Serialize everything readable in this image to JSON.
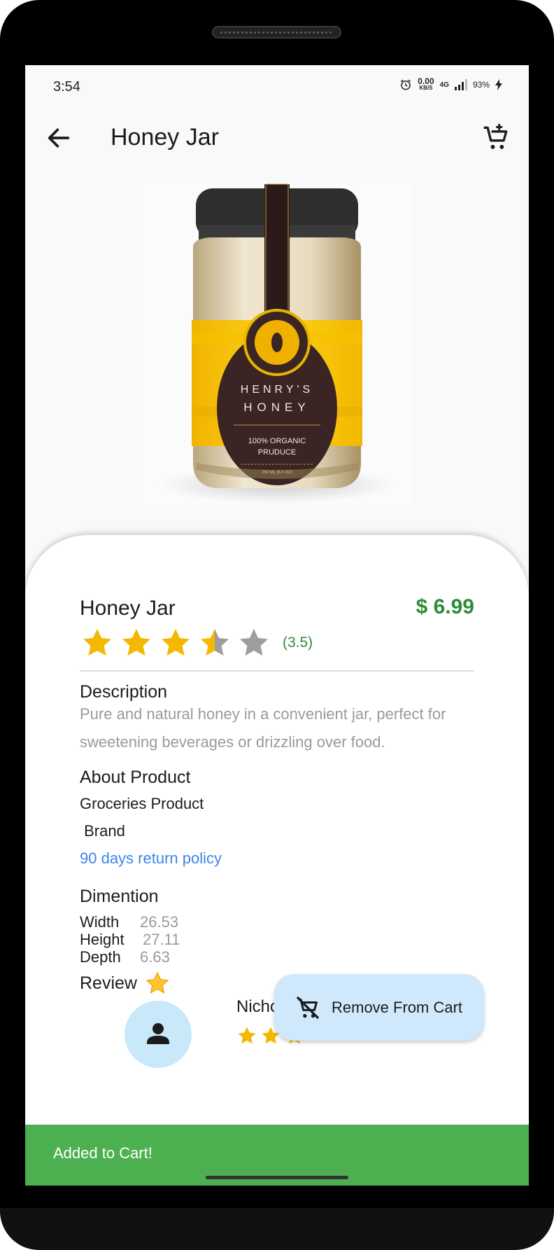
{
  "status": {
    "time": "3:54",
    "net_speed": "0.00",
    "net_unit": "KB/S",
    "network": "4G",
    "battery": "93%"
  },
  "appbar": {
    "title": "Honey Jar"
  },
  "product": {
    "name": "Honey Jar",
    "price": "$ 6.99",
    "rating": 3.5,
    "rating_text": "(3.5)",
    "label": {
      "brand_line1": "HENRY'S",
      "brand_line2": "HONEY",
      "tag_line1": "100% ORGANIC",
      "tag_line2": "PRUDUCE",
      "size": "250 ML (8.4 OZ)"
    }
  },
  "description": {
    "heading": "Description",
    "text": "Pure and natural honey in a convenient jar, perfect for sweetening beverages or drizzling over food."
  },
  "about": {
    "heading": "About Product",
    "category": "Groceries Product",
    "brand": " Brand",
    "return_policy": "90 days return policy"
  },
  "dimension": {
    "heading": "Dimention",
    "width_label": "Width",
    "width": "26.53",
    "height_label": "Height",
    "height": "27.11",
    "depth_label": "Depth",
    "depth": "6.63"
  },
  "review": {
    "heading": "Review",
    "reviewer": "Nicholas",
    "rating": 3
  },
  "fab": {
    "label": "Remove From Cart"
  },
  "snackbar": {
    "text": "Added to Cart!"
  },
  "colors": {
    "accent": "#2e8b3a",
    "link": "#3c86e8",
    "star": "#f5b800",
    "star_empty": "#9e9e9e",
    "snackbar": "#4caf50",
    "fab": "#cfe8fb"
  }
}
